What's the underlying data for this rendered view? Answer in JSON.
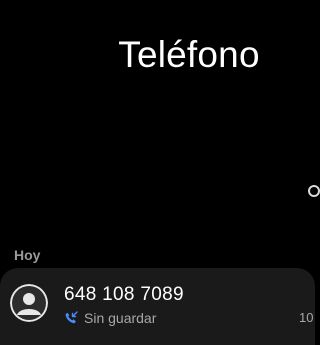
{
  "header": {
    "title": "Teléfono"
  },
  "log": {
    "section_label": "Hoy",
    "entries": [
      {
        "number": "648 108 7089",
        "status": "Sin guardar",
        "time": "10",
        "call_type_icon": "incoming-call-icon"
      }
    ]
  },
  "icons": {
    "avatar": "person-icon",
    "search": "search-icon"
  },
  "colors": {
    "background": "#000000",
    "card": "#1a1a1a",
    "accent": "#4a8cf7",
    "secondary_text": "#a8a8a8"
  }
}
